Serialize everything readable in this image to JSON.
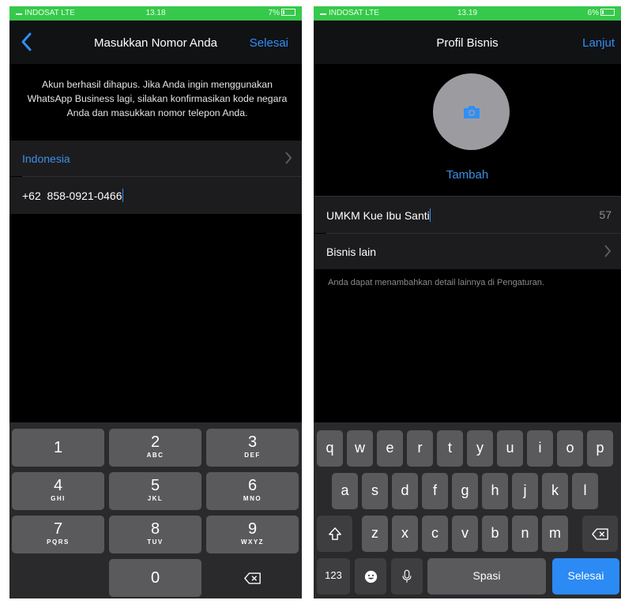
{
  "left": {
    "status": {
      "carrier": "INDOSAT  LTE",
      "time": "13.18",
      "battery": "7%"
    },
    "nav": {
      "title": "Masukkan Nomor Anda",
      "action": "Selesai"
    },
    "info": "Akun berhasil dihapus. Jika Anda ingin menggunakan WhatsApp Business lagi, silakan konfirmasikan kode negara Anda dan masukkan nomor telepon Anda.",
    "country": "Indonesia",
    "phone": {
      "code": "+62",
      "number": "858-0921-0466"
    },
    "numpad": [
      {
        "num": "1",
        "letters": ""
      },
      {
        "num": "2",
        "letters": "ABC"
      },
      {
        "num": "3",
        "letters": "DEF"
      },
      {
        "num": "4",
        "letters": "GHI"
      },
      {
        "num": "5",
        "letters": "JKL"
      },
      {
        "num": "6",
        "letters": "MNO"
      },
      {
        "num": "7",
        "letters": "PQRS"
      },
      {
        "num": "8",
        "letters": "TUV"
      },
      {
        "num": "9",
        "letters": "WXYZ"
      },
      {
        "num": "0",
        "letters": ""
      }
    ],
    "icons": {
      "back": "chevron-left-icon",
      "chevron": "chevron-right-icon",
      "backspace": "backspace-icon"
    }
  },
  "right": {
    "status": {
      "carrier": "INDOSAT  LTE",
      "time": "13.19",
      "battery": "6%"
    },
    "nav": {
      "title": "Profil Bisnis",
      "action": "Lanjut"
    },
    "photo_label": "Tambah",
    "business_name": "UMKM Kue Ibu Santi",
    "char_count": "57",
    "category": "Bisnis lain",
    "hint": "Anda dapat menambahkan detail lainnya di Pengaturan.",
    "keyboard": {
      "row1": [
        "q",
        "w",
        "e",
        "r",
        "t",
        "y",
        "u",
        "i",
        "o",
        "p"
      ],
      "row2": [
        "a",
        "s",
        "d",
        "f",
        "g",
        "h",
        "j",
        "k",
        "l"
      ],
      "row3": [
        "z",
        "x",
        "c",
        "v",
        "b",
        "n",
        "m"
      ],
      "numbers_key": "123",
      "space_key": "Spasi",
      "done_key": "Selesai"
    },
    "icons": {
      "camera": "camera-icon",
      "shift": "shift-icon",
      "emoji": "emoji-icon",
      "mic": "microphone-icon",
      "backspace": "backspace-icon"
    }
  },
  "colors": {
    "accent": "#2f8ff7",
    "status_bar": "#37c94b",
    "keyboard_bg": "#2a2a2c",
    "key": "#5a5a5d"
  }
}
